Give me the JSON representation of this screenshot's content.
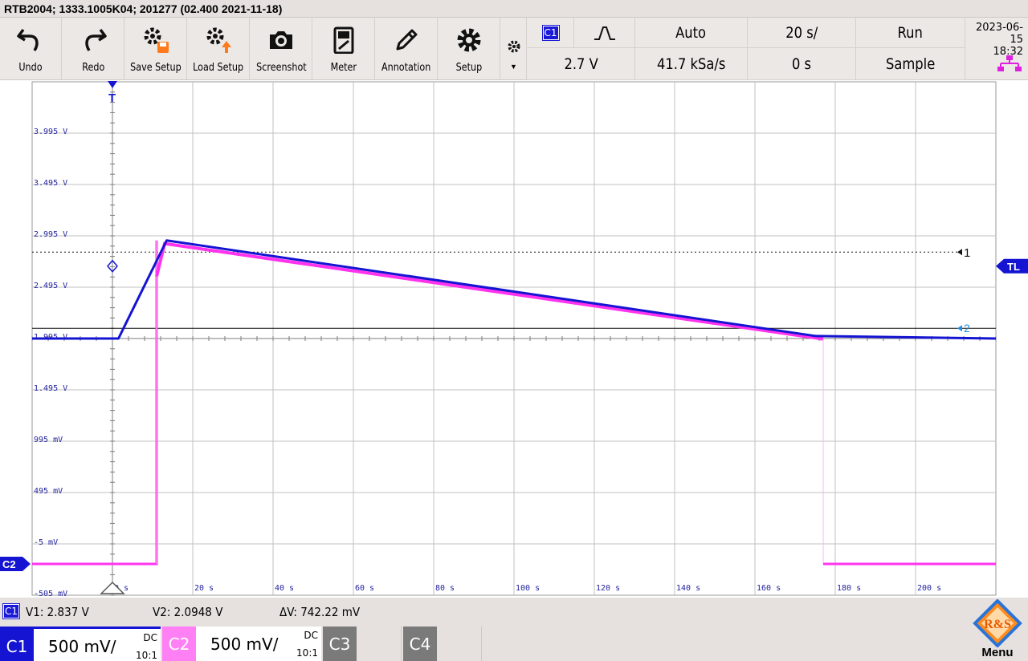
{
  "window": {
    "title": "RTB2004; 1333.1005K04; 201277 (02.400 2021-11-18)"
  },
  "toolbar": {
    "buttons": [
      {
        "id": "undo",
        "label": "Undo",
        "icon": "undo-icon"
      },
      {
        "id": "redo",
        "label": "Redo",
        "icon": "redo-icon"
      },
      {
        "id": "save-setup",
        "label": "Save Setup",
        "icon": "save-setup-icon"
      },
      {
        "id": "load-setup",
        "label": "Load Setup",
        "icon": "load-setup-icon"
      },
      {
        "id": "screenshot",
        "label": "Screenshot",
        "icon": "camera-icon"
      },
      {
        "id": "meter",
        "label": "Meter",
        "icon": "meter-icon"
      },
      {
        "id": "annotation",
        "label": "Annotation",
        "icon": "pencil-icon"
      },
      {
        "id": "setup",
        "label": "Setup",
        "icon": "gear-icon"
      }
    ],
    "more_icon": "small-gear-dropdown-icon"
  },
  "trigger_panel": {
    "source": "C1",
    "slope_icon": "rising-falling-edge-icon",
    "level": "2.7 V",
    "mode": "Auto",
    "sample_rate": "41.7 kSa/s",
    "timebase": "20 s/",
    "position": "0 s",
    "run_state": "Run",
    "acquisition": "Sample"
  },
  "datetime": {
    "date": "2023-06-15",
    "time": "18:32"
  },
  "network_icon": "network-icon",
  "plot": {
    "y_tick_labels": [
      "3.995 V",
      "3.495 V",
      "2.995 V",
      "2.495 V",
      "1.995 V",
      "1.495 V",
      "995 mV",
      "495 mV",
      "-5 mV",
      "-505 mV"
    ],
    "x_tick_labels": [
      "0 s",
      "20 s",
      "40 s",
      "60 s",
      "80 s",
      "100 s",
      "120 s",
      "140 s",
      "160 s",
      "180 s",
      "200 s"
    ],
    "trigger_marker": "T",
    "trigger_level_marker": "TL",
    "cursor_1_label": "1",
    "cursor_2_label": "2",
    "channel_marker": "C2",
    "colors": {
      "c1": "#1414d2",
      "c2": "#ff33ee",
      "grid": "#c0c0c0",
      "axis": "#7c7c7c"
    },
    "c1_trace": {
      "baseline_v": 1.995,
      "baseline_end_s": 1.5,
      "peak_s": 13.5,
      "peak_v": 2.95,
      "decay_end_s": 175,
      "decay_end_v": 2.02,
      "final_v": 1.995
    },
    "c2_trace": {
      "low_v": -0.2,
      "pulse_start_s": 11,
      "pulse_end_s": 177
    }
  },
  "measurements": {
    "channel": "C1",
    "v1": "V1: 2.837 V",
    "v2": "V2: 2.0948 V",
    "dv": "ΔV: 742.22 mV"
  },
  "channels": [
    {
      "name": "C1",
      "scale": "500 mV/",
      "coupling": "DC",
      "probe": "10:1",
      "color": "#1414d2",
      "active": true
    },
    {
      "name": "C2",
      "scale": "500 mV/",
      "coupling": "DC",
      "probe": "10:1",
      "color": "#ff80f5",
      "active": true
    },
    {
      "name": "C3",
      "scale": "",
      "coupling": "",
      "probe": "",
      "color": "#7a7a7a",
      "active": false
    },
    {
      "name": "C4",
      "scale": "",
      "coupling": "",
      "probe": "",
      "color": "#7a7a7a",
      "active": false
    }
  ],
  "logo": {
    "text": "R&S",
    "menu_label": "Menu"
  }
}
